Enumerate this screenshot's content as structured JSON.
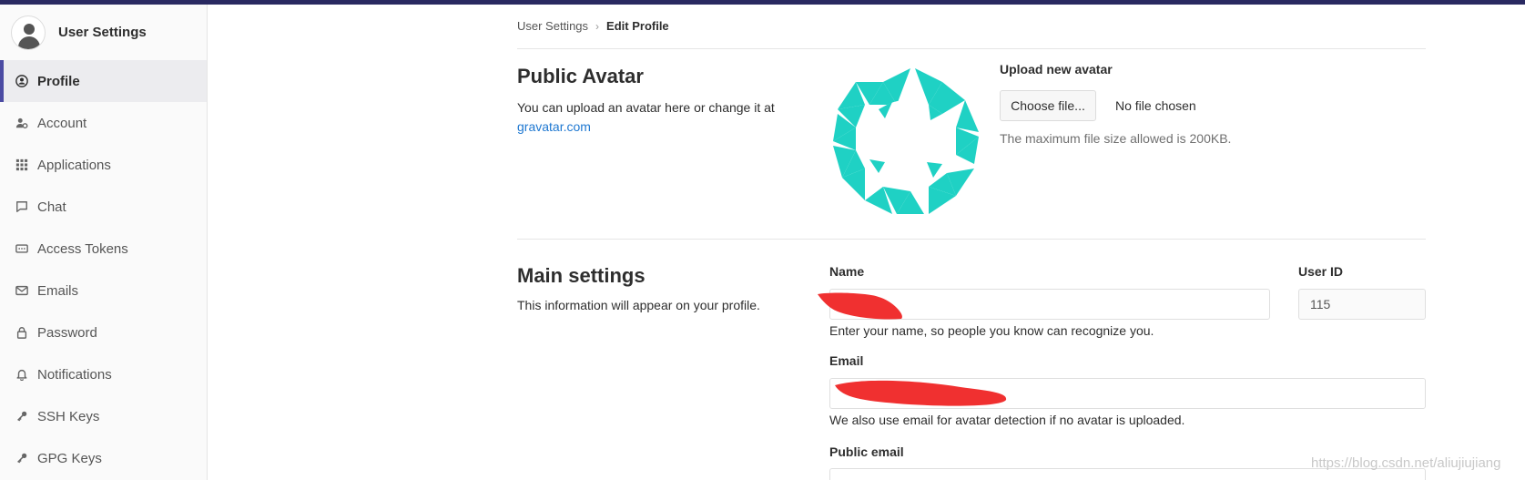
{
  "sidebar": {
    "title": "User Settings",
    "items": [
      {
        "label": "Profile",
        "icon": "profile-icon"
      },
      {
        "label": "Account",
        "icon": "account-icon"
      },
      {
        "label": "Applications",
        "icon": "applications-icon"
      },
      {
        "label": "Chat",
        "icon": "chat-icon"
      },
      {
        "label": "Access Tokens",
        "icon": "access-tokens-icon"
      },
      {
        "label": "Emails",
        "icon": "emails-icon"
      },
      {
        "label": "Password",
        "icon": "password-icon"
      },
      {
        "label": "Notifications",
        "icon": "notifications-icon"
      },
      {
        "label": "SSH Keys",
        "icon": "ssh-keys-icon"
      },
      {
        "label": "GPG Keys",
        "icon": "gpg-keys-icon"
      }
    ]
  },
  "breadcrumb": {
    "parent": "User Settings",
    "current": "Edit Profile"
  },
  "public_avatar": {
    "title": "Public Avatar",
    "desc": "You can upload an avatar here or change it at",
    "link": "gravatar.com",
    "upload_label": "Upload new avatar",
    "choose_button": "Choose file...",
    "no_file": "No file chosen",
    "max_size_help": "The maximum file size allowed is 200KB."
  },
  "main_settings": {
    "title": "Main settings",
    "desc": "This information will appear on your profile.",
    "name_label": "Name",
    "name_help": "Enter your name, so people you know can recognize you.",
    "user_id_label": "User ID",
    "user_id_value": "115",
    "email_label": "Email",
    "email_help": "We also use email for avatar detection if no avatar is uploaded.",
    "public_email_label": "Public email"
  },
  "colors": {
    "topbar": "#292961",
    "active_indicator": "#4b4ba3",
    "link": "#1f78d1",
    "avatar_teal": "#1fd1c4",
    "redaction": "#f03030"
  },
  "watermark": "https://blog.csdn.net/aliujiujiang"
}
